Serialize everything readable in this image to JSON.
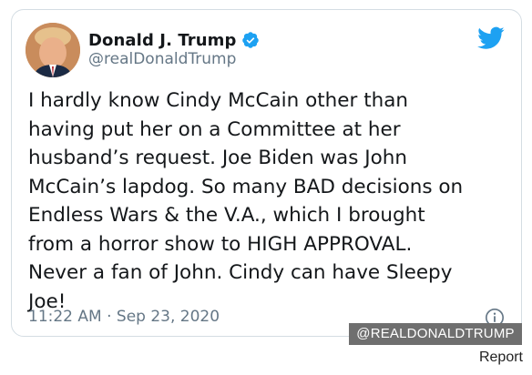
{
  "tweet": {
    "display_name": "Donald J. Trump",
    "handle": "@realDonaldTrump",
    "text": "I hardly know Cindy McCain other than\nhaving put her on a Committee at her\nhusband’s request. Joe Biden was John\nMcCain’s lapdog. So many BAD decisions on\nEndless Wars & the V.A., which I brought\nfrom a horror show to HIGH APPROVAL.\nNever a fan of John. Cindy can have Sleepy\nJoe!",
    "timestamp": "11:22 AM · Sep 23, 2020",
    "icons": {
      "avatar": "profile-photo",
      "verified": "verified-badge-icon",
      "brand": "twitter-bird-icon",
      "info": "info-icon"
    },
    "colors": {
      "brand": "#1da1f2",
      "name": "#14171a",
      "secondary": "#657786",
      "border": "#d4dde3"
    }
  },
  "overlay": {
    "watermark": "@REALDONALDTRUMP",
    "report_label": "Report"
  }
}
